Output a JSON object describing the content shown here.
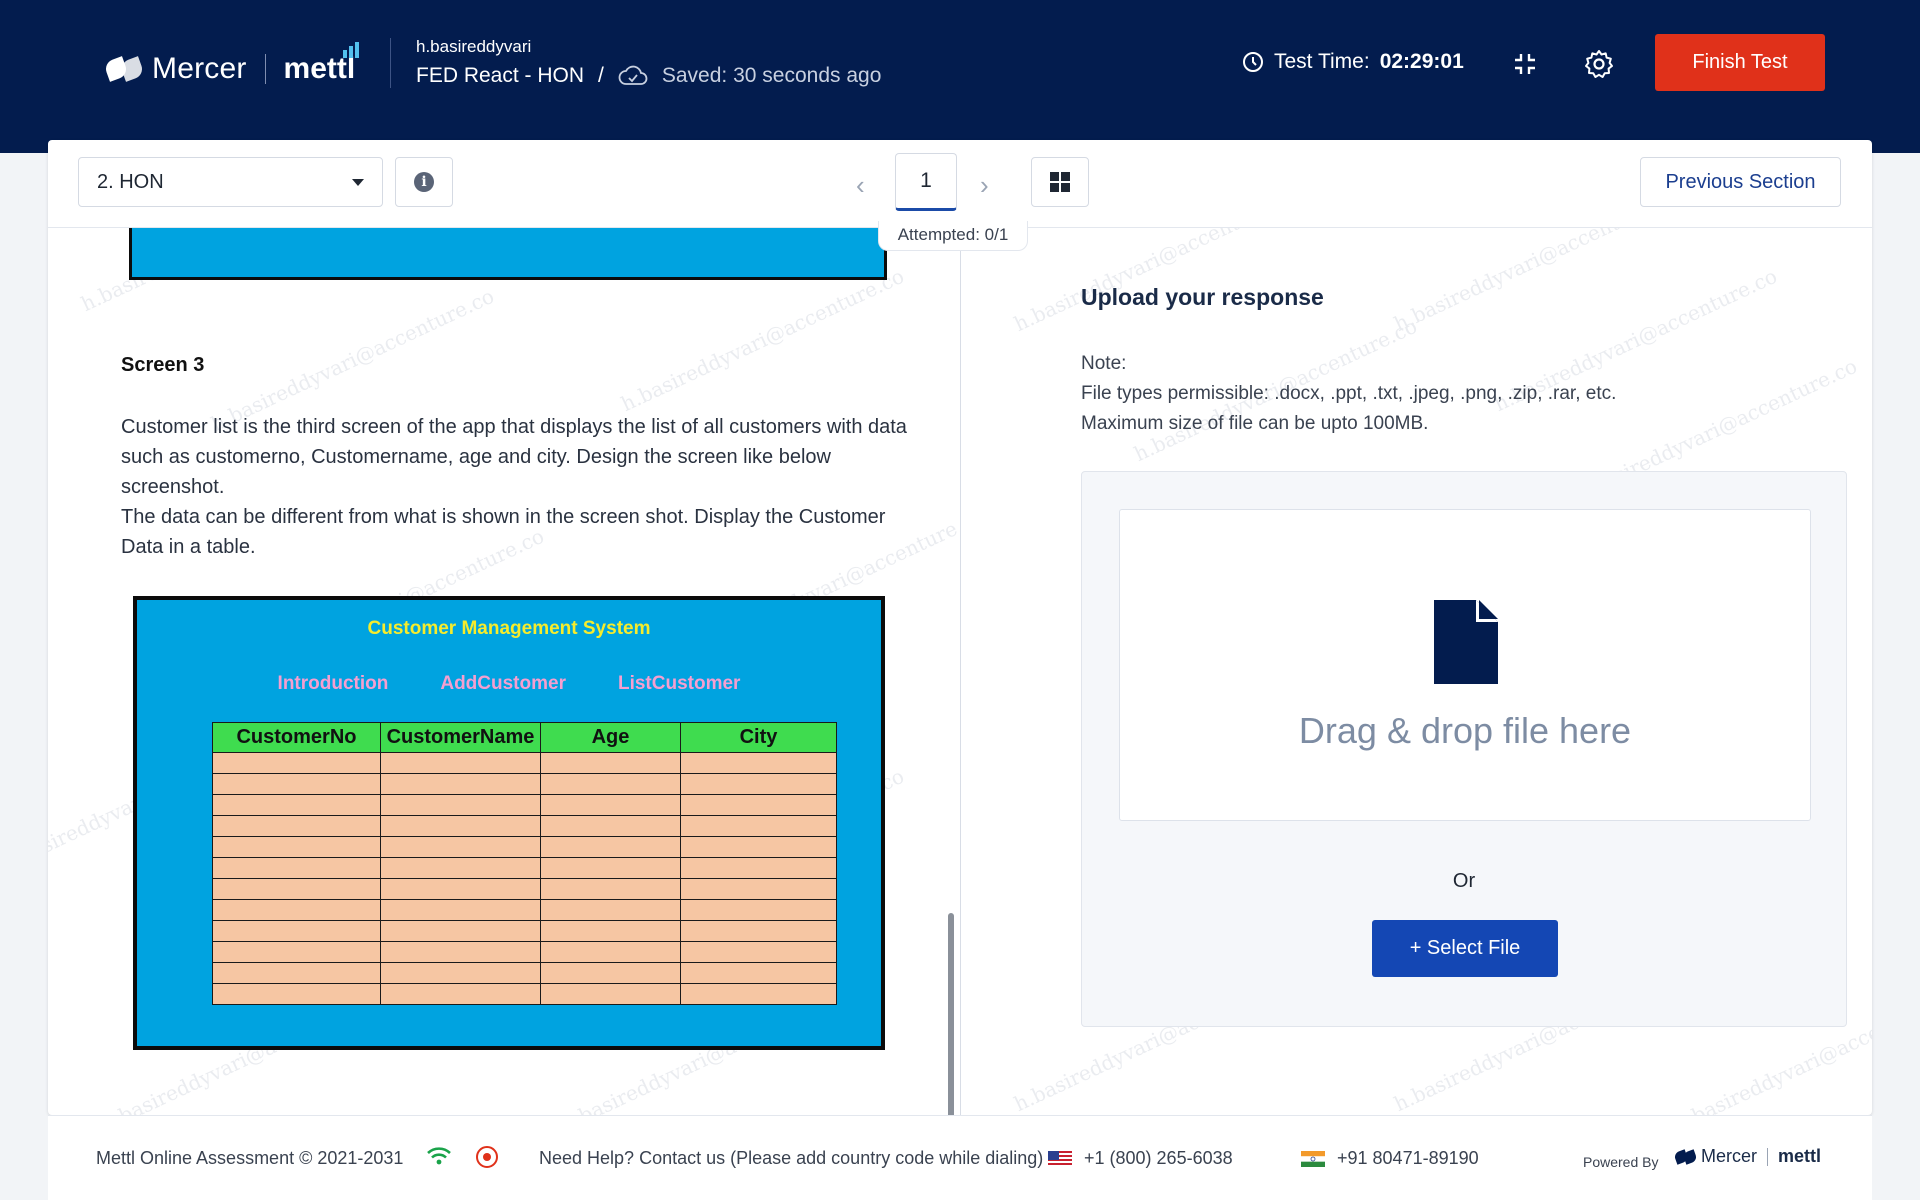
{
  "header": {
    "brand_mercer": "Mercer",
    "brand_mettl": "mettl",
    "user_name": "h.basireddyvari",
    "test_name": "FED React - HON",
    "separator": "/",
    "saved_status": "Saved: 30 seconds ago",
    "timer_label": "Test Time:",
    "timer_value": "02:29:01",
    "finish_label": "Finish Test"
  },
  "toolbar": {
    "section_selected": "2. HON",
    "page_number": "1",
    "attempted": "Attempted: 0/1",
    "previous_section": "Previous Section",
    "prev_arrow": "‹",
    "next_arrow": "›"
  },
  "question": {
    "screen_label": "Screen 3",
    "description_lines": [
      "Customer list is the third screen of the app that displays the list of all customers with data such as customerno, Customername, age and city. Design the screen like below screenshot.",
      "The data can be different from what is shown in the screen shot. Display the Customer Data in a table."
    ],
    "screenshot": {
      "title": "Customer Management System",
      "nav": [
        "Introduction",
        "AddCustomer",
        "ListCustomer"
      ],
      "columns": [
        "CustomerNo",
        "CustomerName",
        "Age",
        "City"
      ],
      "empty_rows": 12
    }
  },
  "upload": {
    "title": "Upload your response",
    "note_label": "Note:",
    "file_types": "File types permissible: .docx, .ppt, .txt, .jpeg, .png, .zip, .rar, etc.",
    "max_size": "Maximum size of file can be upto 100MB.",
    "drop_text": "Drag & drop file here",
    "or_text": "Or",
    "select_file": "+ Select File"
  },
  "footer": {
    "copyright": "Mettl Online Assessment © 2021-2031",
    "help": "Need Help? Contact us (Please add country code while dialing)",
    "us_phone": "+1 (800) 265-6038",
    "in_phone": "+91 80471-89190",
    "powered_by": "Powered By",
    "powered_mercer": "Mercer",
    "powered_mettl": "mettl"
  },
  "watermark_text": "h.basireddyvari@accenture.co",
  "colors": {
    "header_bg": "#031c4e",
    "finish_btn": "#e0311a",
    "primary_btn": "#1447b4",
    "screenshot_bg": "#00a3e0",
    "screenshot_header": "#3fdc4f",
    "screenshot_cell": "#f6c6a3"
  },
  "icons": [
    "clock-icon",
    "cloud-check-icon",
    "collapse-icon",
    "gear-icon",
    "info-icon",
    "grid-icon",
    "file-icon",
    "wifi-icon",
    "record-icon",
    "us-flag-icon",
    "india-flag-icon"
  ]
}
